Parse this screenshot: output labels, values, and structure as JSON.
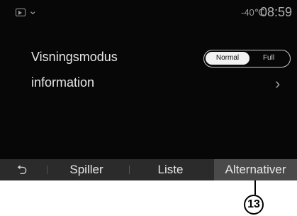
{
  "status_bar": {
    "source_icon": "media-source-icon",
    "temperature": "-40℃",
    "time": "08:59"
  },
  "settings": {
    "display_mode": {
      "label": "Visningsmodus",
      "options": [
        "Normal",
        "Full"
      ],
      "selected": "Normal"
    },
    "information": {
      "label": "information"
    }
  },
  "tabs": {
    "back_icon": "back-arrow-icon",
    "player": "Spiller",
    "list": "Liste",
    "options": "Alternativer",
    "active": "Alternativer"
  },
  "callout": {
    "number": "13"
  }
}
